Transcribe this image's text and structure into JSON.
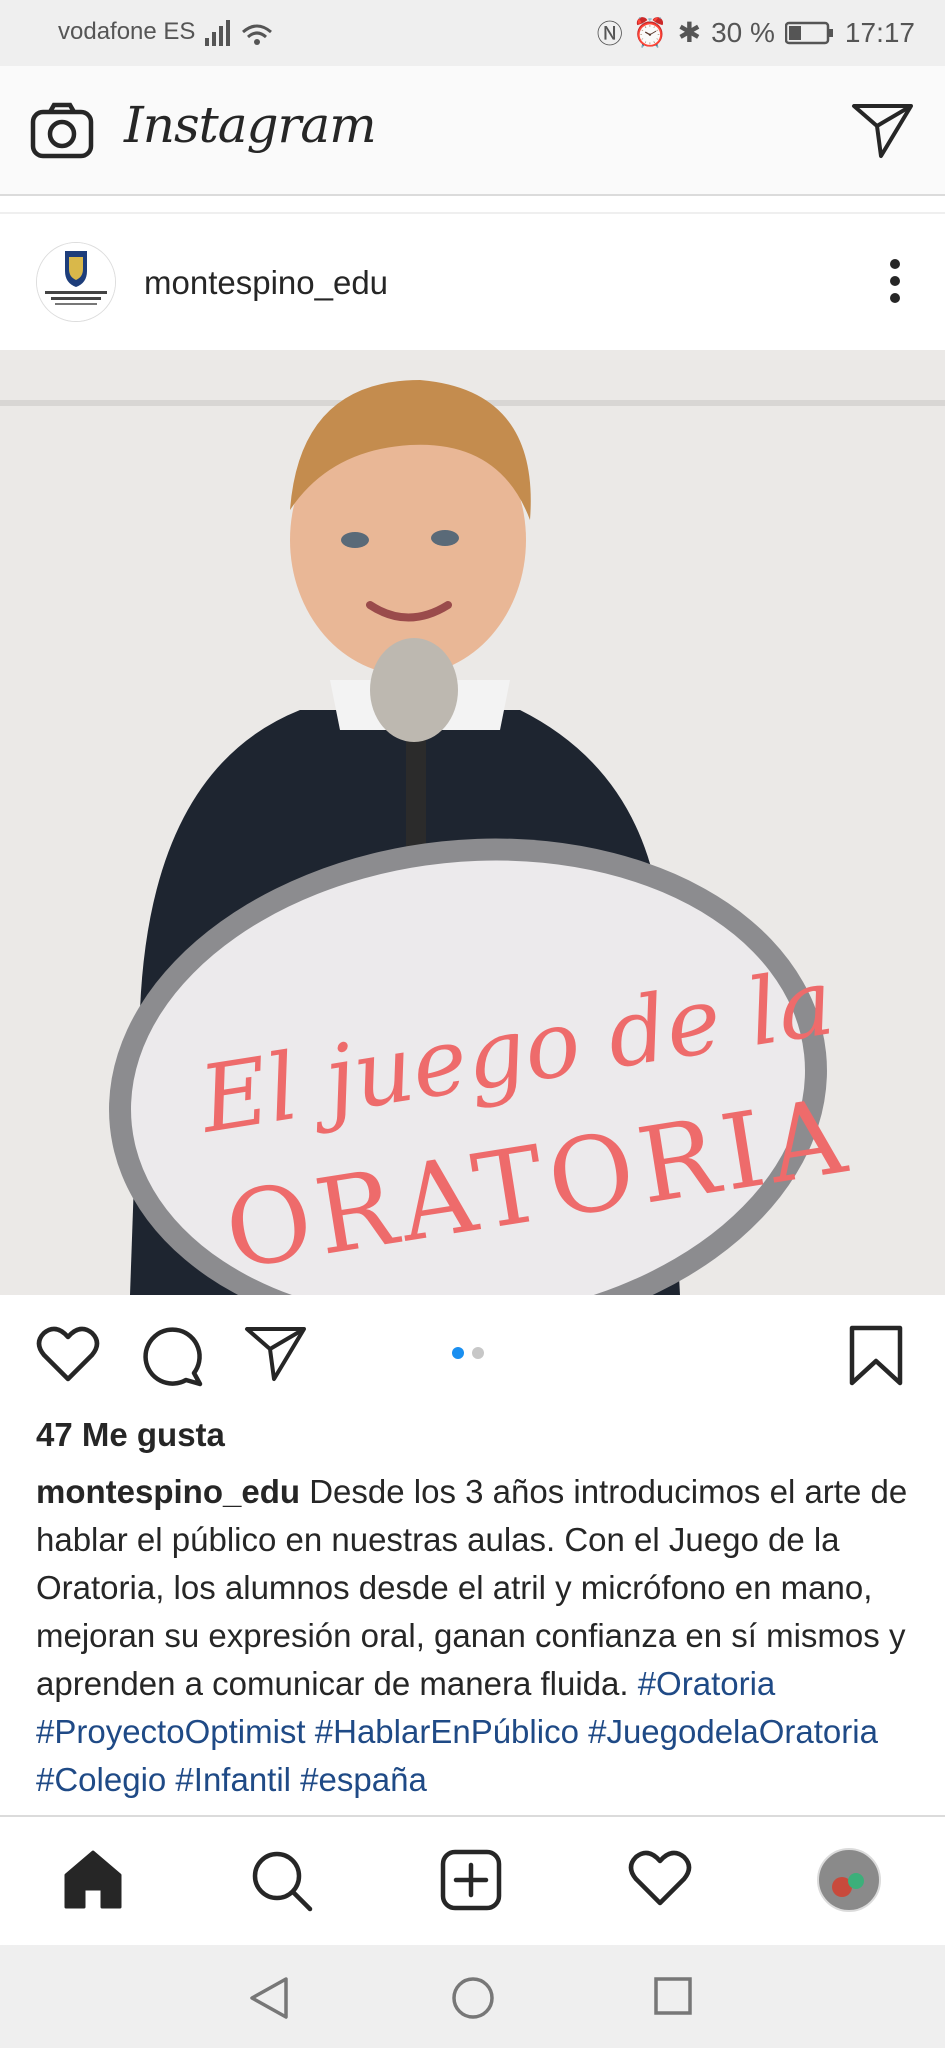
{
  "status_bar": {
    "carrier": "vodafone ES",
    "battery": "30 %",
    "time": "17:17"
  },
  "top_bar": {
    "app_title": "Instagram",
    "camera_icon": "camera-icon",
    "direct_icon": "paper-plane-icon"
  },
  "post": {
    "username": "montespino_edu",
    "avatar_label": "COLEGIO DE FOMENTO MONTESPINO",
    "image_text_line1": "El juego de la",
    "image_text_line2": "ORATORIA",
    "likes": "47 Me gusta",
    "caption_user": "montespino_edu",
    "caption_text": " Desde los 3 años introducimos el arte de hablar el público en nuestras aulas. Con el Juego de la Oratoria, los alumnos desde el atril y micrófono en mano, mejoran su expresión oral, ganan confianza en sí mismos y aprenden a comunicar de manera fluida. ",
    "hashtags": "#Oratoria #ProyectoOptimist #HablarEnPúblico #JuegodelaOratoria #Colegio #Infantil #españa",
    "carousel": {
      "count": 2,
      "active": 1
    }
  },
  "colors": {
    "accent_blue": "#1a8ff0",
    "hashtag": "#1f4a86",
    "text": "#262626"
  }
}
